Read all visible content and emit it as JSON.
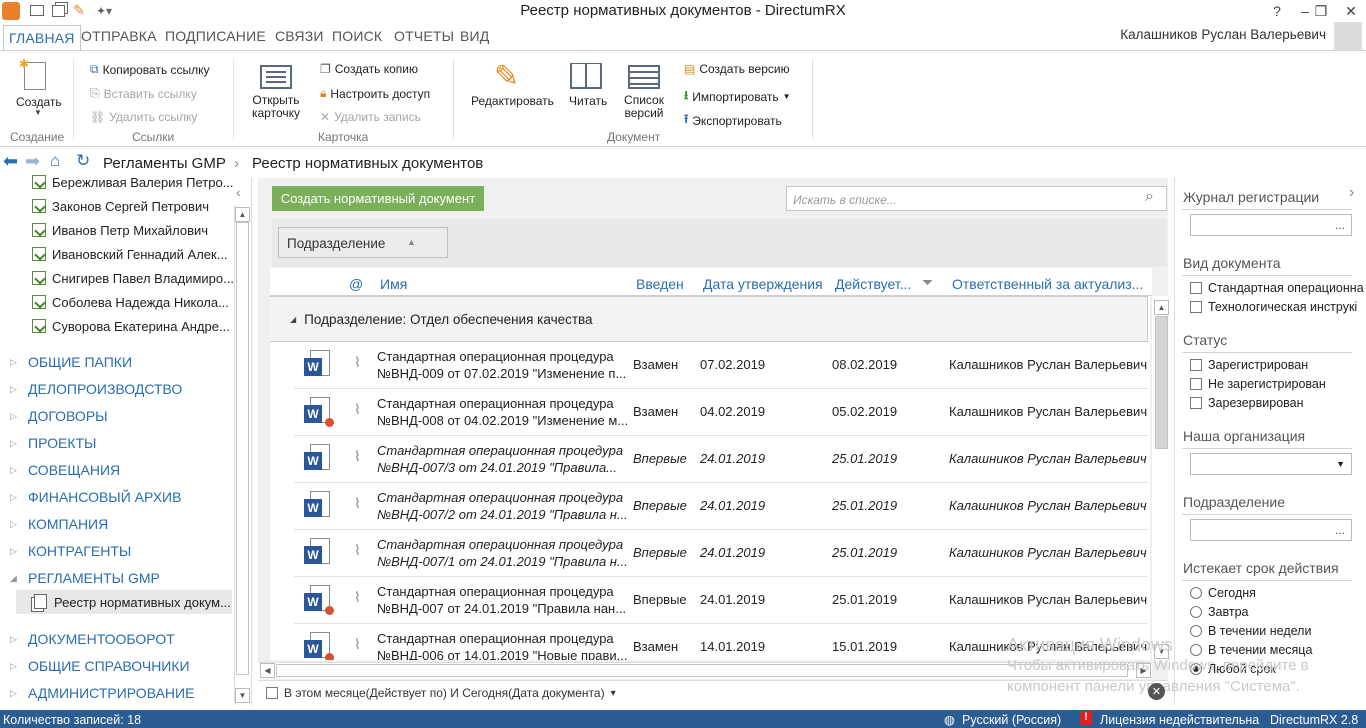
{
  "window": {
    "title": "Реестр нормативных документов - DirectumRX",
    "minimize": "–",
    "restore": "❐",
    "close": "✕",
    "help": "?"
  },
  "menu": {
    "tabs": [
      "ГЛАВНАЯ",
      "ОТПРАВКА",
      "ПОДПИСАНИЕ",
      "СВЯЗИ",
      "ПОИСК",
      "ОТЧЕТЫ",
      "ВИД"
    ],
    "user": "Калашников Руслан Валерьевич"
  },
  "ribbon": {
    "create": "Создать",
    "create_group": "Создание",
    "copy_link": "Копировать ссылку",
    "paste_link": "Вставить ссылку",
    "delete_link": "Удалить ссылку",
    "links_group": "Ссылки",
    "open_card": "Открыть карточку",
    "open_card_l1": "Открыть",
    "open_card_l2": "карточку",
    "create_copy": "Создать копию",
    "set_access": "Настроить доступ",
    "delete_record": "Удалить запись",
    "card_group": "Карточка",
    "edit": "Редактировать",
    "read": "Читать",
    "versions_l1": "Список",
    "versions_l2": "версий",
    "create_version": "Создать версию",
    "import": "Импортировать",
    "export": "Экспортировать",
    "document_group": "Документ"
  },
  "breadcrumb": {
    "parent": "Регламенты GMP",
    "separator": "›",
    "current": "Реестр нормативных документов"
  },
  "sidebar": {
    "employees": [
      "Бережливая Валерия Петро...",
      "Законов Сергей Петрович",
      "Иванов Петр Михайлович",
      "Ивановский Геннадий Алек...",
      "Снигирев Павел Владимиро...",
      "Соболева Надежда Никола...",
      "Суворова Екатерина Андре..."
    ],
    "sections": [
      "ОБЩИЕ ПАПКИ",
      "ДЕЛОПРОИЗВОДСТВО",
      "ДОГОВОРЫ",
      "ПРОЕКТЫ",
      "СОВЕЩАНИЯ",
      "ФИНАНСОВЫЙ АРХИВ",
      "КОМПАНИЯ",
      "КОНТРАГЕНТЫ",
      "РЕГЛАМЕНТЫ GMP"
    ],
    "selected_item": "Реестр нормативных докум...",
    "sections_after": [
      "ДОКУМЕНТООБОРОТ",
      "ОБЩИЕ СПРАВОЧНИКИ",
      "АДМИНИСТРИРОВАНИЕ"
    ]
  },
  "list": {
    "create_button": "Создать нормативный документ",
    "search_placeholder": "Искать в списке...",
    "group_by": "Подразделение",
    "columns": {
      "at": "@",
      "name": "Имя",
      "intro": "Введен",
      "approved": "Дата утверждения",
      "effective": "Действует...",
      "responsible": "Ответственный за актуализ..."
    },
    "group_label": "Подразделение: Отдел обеспечения качества",
    "rows": [
      {
        "l1": "Стандартная операционная процедура",
        "l2": "№ВНД-009 от 07.02.2019 \"Изменение п...",
        "intro": "Взамен",
        "approved": "07.02.2019",
        "effective": "08.02.2019",
        "responsible": "Калашников Руслан Валерьевич",
        "italic": false,
        "badge": false
      },
      {
        "l1": "Стандартная операционная процедура",
        "l2": "№ВНД-008 от 04.02.2019 \"Изменение м...",
        "intro": "Взамен",
        "approved": "04.02.2019",
        "effective": "05.02.2019",
        "responsible": "Калашников Руслан Валерьевич",
        "italic": false,
        "badge": true
      },
      {
        "l1": "Стандартная операционная процедура",
        "l2": "№ВНД-007/3 от 24.01.2019 \"Правила...",
        "intro": "Впервые",
        "approved": "24.01.2019",
        "effective": "25.01.2019",
        "responsible": "Калашников Руслан Валерьевич",
        "italic": true,
        "badge": false
      },
      {
        "l1": "Стандартная операционная процедура",
        "l2": "№ВНД-007/2 от 24.01.2019 \"Правила н...",
        "intro": "Впервые",
        "approved": "24.01.2019",
        "effective": "25.01.2019",
        "responsible": "Калашников Руслан Валерьевич",
        "italic": true,
        "badge": false
      },
      {
        "l1": "Стандартная операционная процедура",
        "l2": "№ВНД-007/1 от 24.01.2019 \"Правила н...",
        "intro": "Впервые",
        "approved": "24.01.2019",
        "effective": "25.01.2019",
        "responsible": "Калашников Руслан Валерьевич",
        "italic": true,
        "badge": false
      },
      {
        "l1": "Стандартная операционная процедура",
        "l2": "№ВНД-007 от 24.01.2019 \"Правила нан...",
        "intro": "Впервые",
        "approved": "24.01.2019",
        "effective": "25.01.2019",
        "responsible": "Калашников Руслан Валерьевич",
        "italic": false,
        "badge": true
      },
      {
        "l1": "Стандартная операционная процедура",
        "l2": "№ВНД-006 от 14.01.2019 \"Новые прави...",
        "intro": "Взамен",
        "approved": "14.01.2019",
        "effective": "15.01.2019",
        "responsible": "Калашников Руслан Валерьевич",
        "italic": false,
        "badge": true
      }
    ],
    "filter_text": "В этом месяце(Действует по) И Сегодня(Дата документа)",
    "filter_arrow": "▾"
  },
  "filters": {
    "journal": "Журнал регистрации",
    "doc_kind": "Вид документа",
    "kind_options": [
      "Стандартная операционна",
      "Технологическая инструкі"
    ],
    "status": "Статус",
    "status_options": [
      "Зарегистрирован",
      "Не зарегистрирован",
      "Зарезервирован"
    ],
    "org": "Наша организация",
    "department": "Подразделение",
    "expiry": "Истекает срок действия",
    "expiry_options": [
      "Сегодня",
      "Завтра",
      "В течении недели",
      "В течении месяца",
      "Любой срок"
    ],
    "ellipsis": "...",
    "dropdown": "▼",
    "collapse": "›"
  },
  "watermark": {
    "l1": "Активация Windows",
    "l2": "Чтобы активировать Windows, перейдите в",
    "l3": "компонент панели управления \"Система\"."
  },
  "status": {
    "records": "Количество записей: 18",
    "language": "Русский (Россия)",
    "license": "Лицензия недействительна",
    "version": "DirectumRX 2.8"
  },
  "colors": {
    "accent": "#2a6db0",
    "create_button": "#7ab05a",
    "status_bar": "#2b5d92",
    "word": "#2b579a",
    "badge": "#d9502e"
  }
}
